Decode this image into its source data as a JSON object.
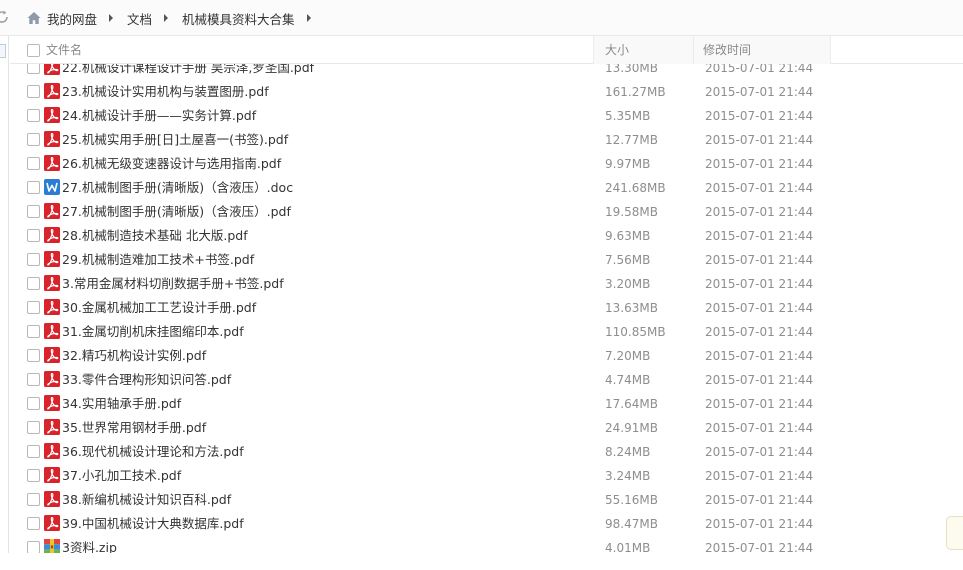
{
  "breadcrumb": {
    "items": [
      "我的网盘",
      "文档",
      "机械模具资料大合集"
    ]
  },
  "columns": {
    "name": "文件名",
    "size": "大小",
    "modified": "修改时间"
  },
  "files": [
    {
      "name": "22.机械设计课程设计手册 吴宗泽,罗圣国.pdf",
      "size": "13.30MB",
      "modified": "2015-07-01 21:44",
      "icon": "pdf-icon"
    },
    {
      "name": "23.机械设计实用机构与装置图册.pdf",
      "size": "161.27MB",
      "modified": "2015-07-01 21:44",
      "icon": "pdf-icon"
    },
    {
      "name": "24.机械设计手册——实务计算.pdf",
      "size": "5.35MB",
      "modified": "2015-07-01 21:44",
      "icon": "pdf-icon"
    },
    {
      "name": "25.机械实用手册[日]土屋喜一(书签).pdf",
      "size": "12.77MB",
      "modified": "2015-07-01 21:44",
      "icon": "pdf-icon"
    },
    {
      "name": "26.机械无级变速器设计与选用指南.pdf",
      "size": "9.97MB",
      "modified": "2015-07-01 21:44",
      "icon": "pdf-icon"
    },
    {
      "name": "27.机械制图手册(清晰版)（含液压）.doc",
      "size": "241.68MB",
      "modified": "2015-07-01 21:44",
      "icon": "word-icon"
    },
    {
      "name": "27.机械制图手册(清晰版)（含液压）.pdf",
      "size": "19.58MB",
      "modified": "2015-07-01 21:44",
      "icon": "pdf-icon"
    },
    {
      "name": "28.机械制造技术基础 北大版.pdf",
      "size": "9.63MB",
      "modified": "2015-07-01 21:44",
      "icon": "pdf-icon"
    },
    {
      "name": "29.机械制造难加工技术+书签.pdf",
      "size": "7.56MB",
      "modified": "2015-07-01 21:44",
      "icon": "pdf-icon"
    },
    {
      "name": "3.常用金属材料切削数据手册+书签.pdf",
      "size": "3.20MB",
      "modified": "2015-07-01 21:44",
      "icon": "pdf-icon"
    },
    {
      "name": "30.金属机械加工工艺设计手册.pdf",
      "size": "13.63MB",
      "modified": "2015-07-01 21:44",
      "icon": "pdf-icon"
    },
    {
      "name": "31.金属切削机床挂图缩印本.pdf",
      "size": "110.85MB",
      "modified": "2015-07-01 21:44",
      "icon": "pdf-icon"
    },
    {
      "name": "32.精巧机构设计实例.pdf",
      "size": "7.20MB",
      "modified": "2015-07-01 21:44",
      "icon": "pdf-icon"
    },
    {
      "name": "33.零件合理构形知识问答.pdf",
      "size": "4.74MB",
      "modified": "2015-07-01 21:44",
      "icon": "pdf-icon"
    },
    {
      "name": "34.实用轴承手册.pdf",
      "size": "17.64MB",
      "modified": "2015-07-01 21:44",
      "icon": "pdf-icon"
    },
    {
      "name": "35.世界常用钢材手册.pdf",
      "size": "24.91MB",
      "modified": "2015-07-01 21:44",
      "icon": "pdf-icon"
    },
    {
      "name": "36.现代机械设计理论和方法.pdf",
      "size": "8.24MB",
      "modified": "2015-07-01 21:44",
      "icon": "pdf-icon"
    },
    {
      "name": "37.小孔加工技术.pdf",
      "size": "3.24MB",
      "modified": "2015-07-01 21:44",
      "icon": "pdf-icon"
    },
    {
      "name": "38.新编机械设计知识百科.pdf",
      "size": "55.16MB",
      "modified": "2015-07-01 21:44",
      "icon": "pdf-icon"
    },
    {
      "name": "39.中国机械设计大典数据库.pdf",
      "size": "98.47MB",
      "modified": "2015-07-01 21:44",
      "icon": "pdf-icon"
    },
    {
      "name": "3资料.zip",
      "size": "4.01MB",
      "modified": "2015-07-01 21:44",
      "icon": "zip-icon"
    }
  ],
  "colors": {
    "pdf": "#d8232a",
    "word": "#2b7cd3",
    "header_text": "#8a8a8a",
    "meta_text": "#8e8e8e"
  }
}
